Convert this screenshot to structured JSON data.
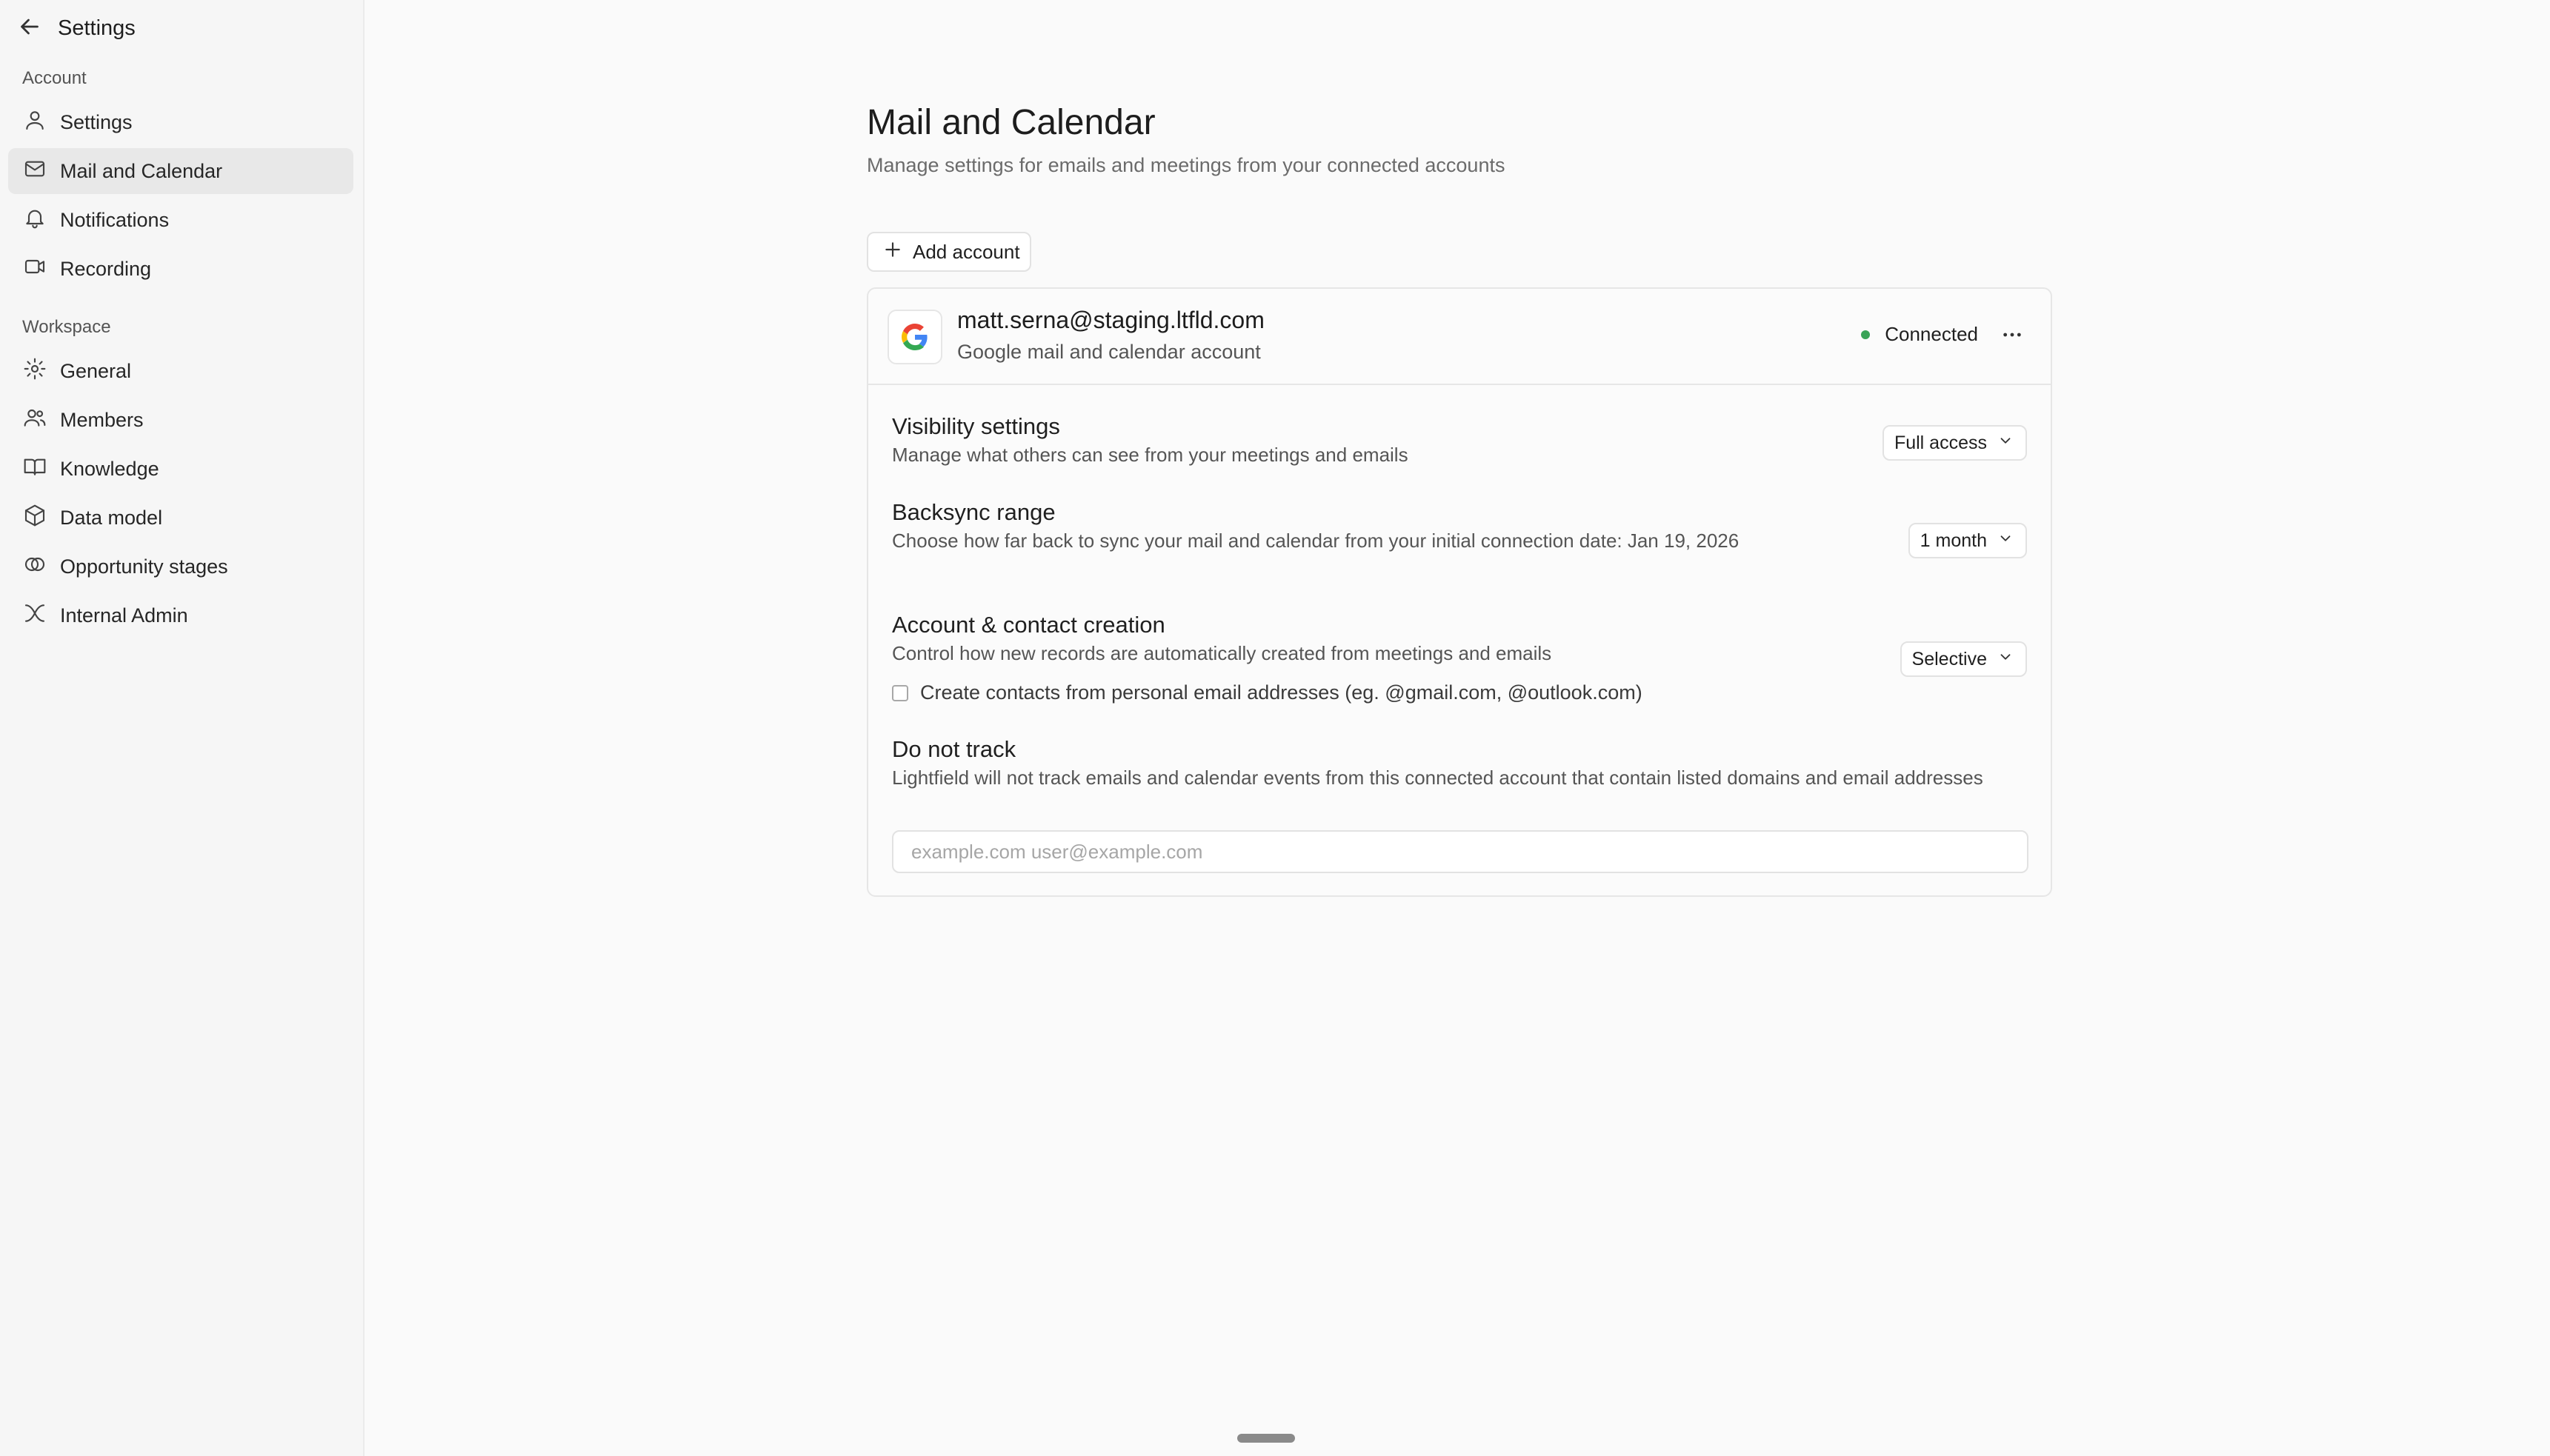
{
  "sidebar": {
    "header": {
      "title": "Settings",
      "back_icon": "arrow-left-icon"
    },
    "sections": [
      {
        "label": "Account",
        "items": [
          {
            "label": "Settings",
            "icon": "user-icon",
            "active": false
          },
          {
            "label": "Mail and Calendar",
            "icon": "mail-icon",
            "active": true
          },
          {
            "label": "Notifications",
            "icon": "bell-icon",
            "active": false
          },
          {
            "label": "Recording",
            "icon": "video-icon",
            "active": false
          }
        ]
      },
      {
        "label": "Workspace",
        "items": [
          {
            "label": "General",
            "icon": "gear-icon",
            "active": false
          },
          {
            "label": "Members",
            "icon": "users-icon",
            "active": false
          },
          {
            "label": "Knowledge",
            "icon": "book-icon",
            "active": false
          },
          {
            "label": "Data model",
            "icon": "cube-icon",
            "active": false
          },
          {
            "label": "Opportunity stages",
            "icon": "circles-icon",
            "active": false
          },
          {
            "label": "Internal Admin",
            "icon": "admin-icon",
            "active": false
          }
        ]
      }
    ]
  },
  "main": {
    "title": "Mail and Calendar",
    "subtitle": "Manage settings for emails and meetings from your connected accounts",
    "add_account_label": "Add account",
    "account": {
      "email": "matt.serna@staging.ltfld.com",
      "type": "Google mail and calendar account",
      "status": "Connected",
      "status_color": "#3aa357",
      "provider_icon": "google-icon"
    },
    "settings": {
      "visibility": {
        "title": "Visibility settings",
        "description": "Manage what others can see from your meetings and emails",
        "value": "Full access"
      },
      "backsync": {
        "title": "Backsync range",
        "description": "Choose how far back to sync your mail and calendar from your initial connection date: Jan 19, 2026",
        "value": "1 month"
      },
      "creation": {
        "title": "Account & contact creation",
        "description": "Control how new records are automatically created from meetings and emails",
        "value": "Selective",
        "checkbox_label": "Create contacts from personal email addresses (eg. @gmail.com, @outlook.com)",
        "checkbox_checked": false
      },
      "do_not_track": {
        "title": "Do not track",
        "description": "Lightfield will not track emails and calendar events from this connected account that contain listed domains and email addresses",
        "value": "",
        "placeholder": "example.com user@example.com"
      }
    }
  }
}
